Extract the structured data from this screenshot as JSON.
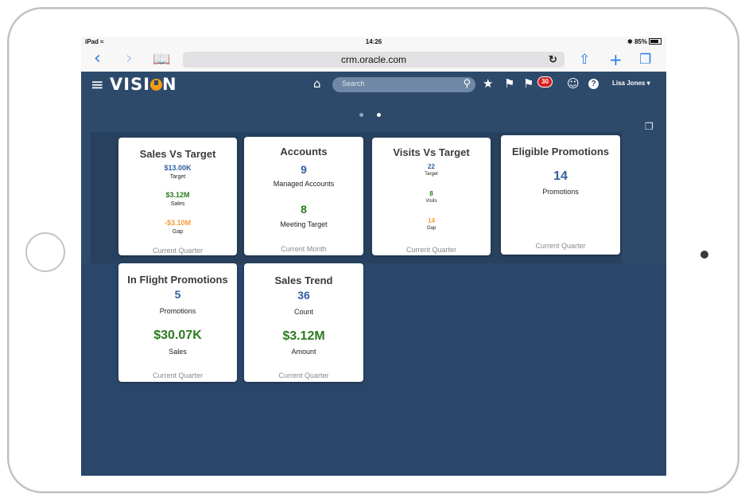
{
  "status_bar": {
    "device": "iPad",
    "time": "14:26",
    "battery": "85%"
  },
  "browser": {
    "url": "crm.oracle.com"
  },
  "app": {
    "brand": "VISION",
    "search_placeholder": "Search",
    "notification_count": "30",
    "user": "Lisa Jones"
  },
  "cards": {
    "sales_vs_target": {
      "title": "Sales Vs Target",
      "target_value": "$13.00K",
      "target_label": "Target",
      "sales_value": "$3.12M",
      "sales_label": "Sales",
      "gap_value": "-$3.10M",
      "gap_label": "Gap",
      "footer": "Current Quarter"
    },
    "accounts": {
      "title": "Accounts",
      "managed_value": "9",
      "managed_label": "Managed Accounts",
      "meeting_value": "8",
      "meeting_label": "Meeting Target",
      "footer": "Current Month"
    },
    "visits_vs_target": {
      "title": "Visits Vs Target",
      "target_value": "22",
      "target_label": "Target",
      "visits_value": "8",
      "visits_label": "Visits",
      "gap_value": "14",
      "gap_label": "Gap",
      "footer": "Current Quarter"
    },
    "eligible_promotions": {
      "title": "Eligible Promotions",
      "value": "14",
      "label": "Promotions",
      "footer": "Current Quarter"
    },
    "in_flight_promotions": {
      "title": "In Flight Promotions",
      "count_value": "5",
      "count_label": "Promotions",
      "sales_value": "$30.07K",
      "sales_label": "Sales",
      "footer": "Current Quarter"
    },
    "sales_trend": {
      "title": "Sales Trend",
      "count_value": "36",
      "count_label": "Count",
      "amount_value": "$3.12M",
      "amount_label": "Amount",
      "footer": "Current Quarter"
    }
  },
  "colors": {
    "header_bg": "#2e4a6b",
    "accent_blue": "#2f5f9e",
    "positive_green": "#2b7a1f",
    "warning_orange": "#f0a038",
    "notification_red": "#d61d1d"
  }
}
